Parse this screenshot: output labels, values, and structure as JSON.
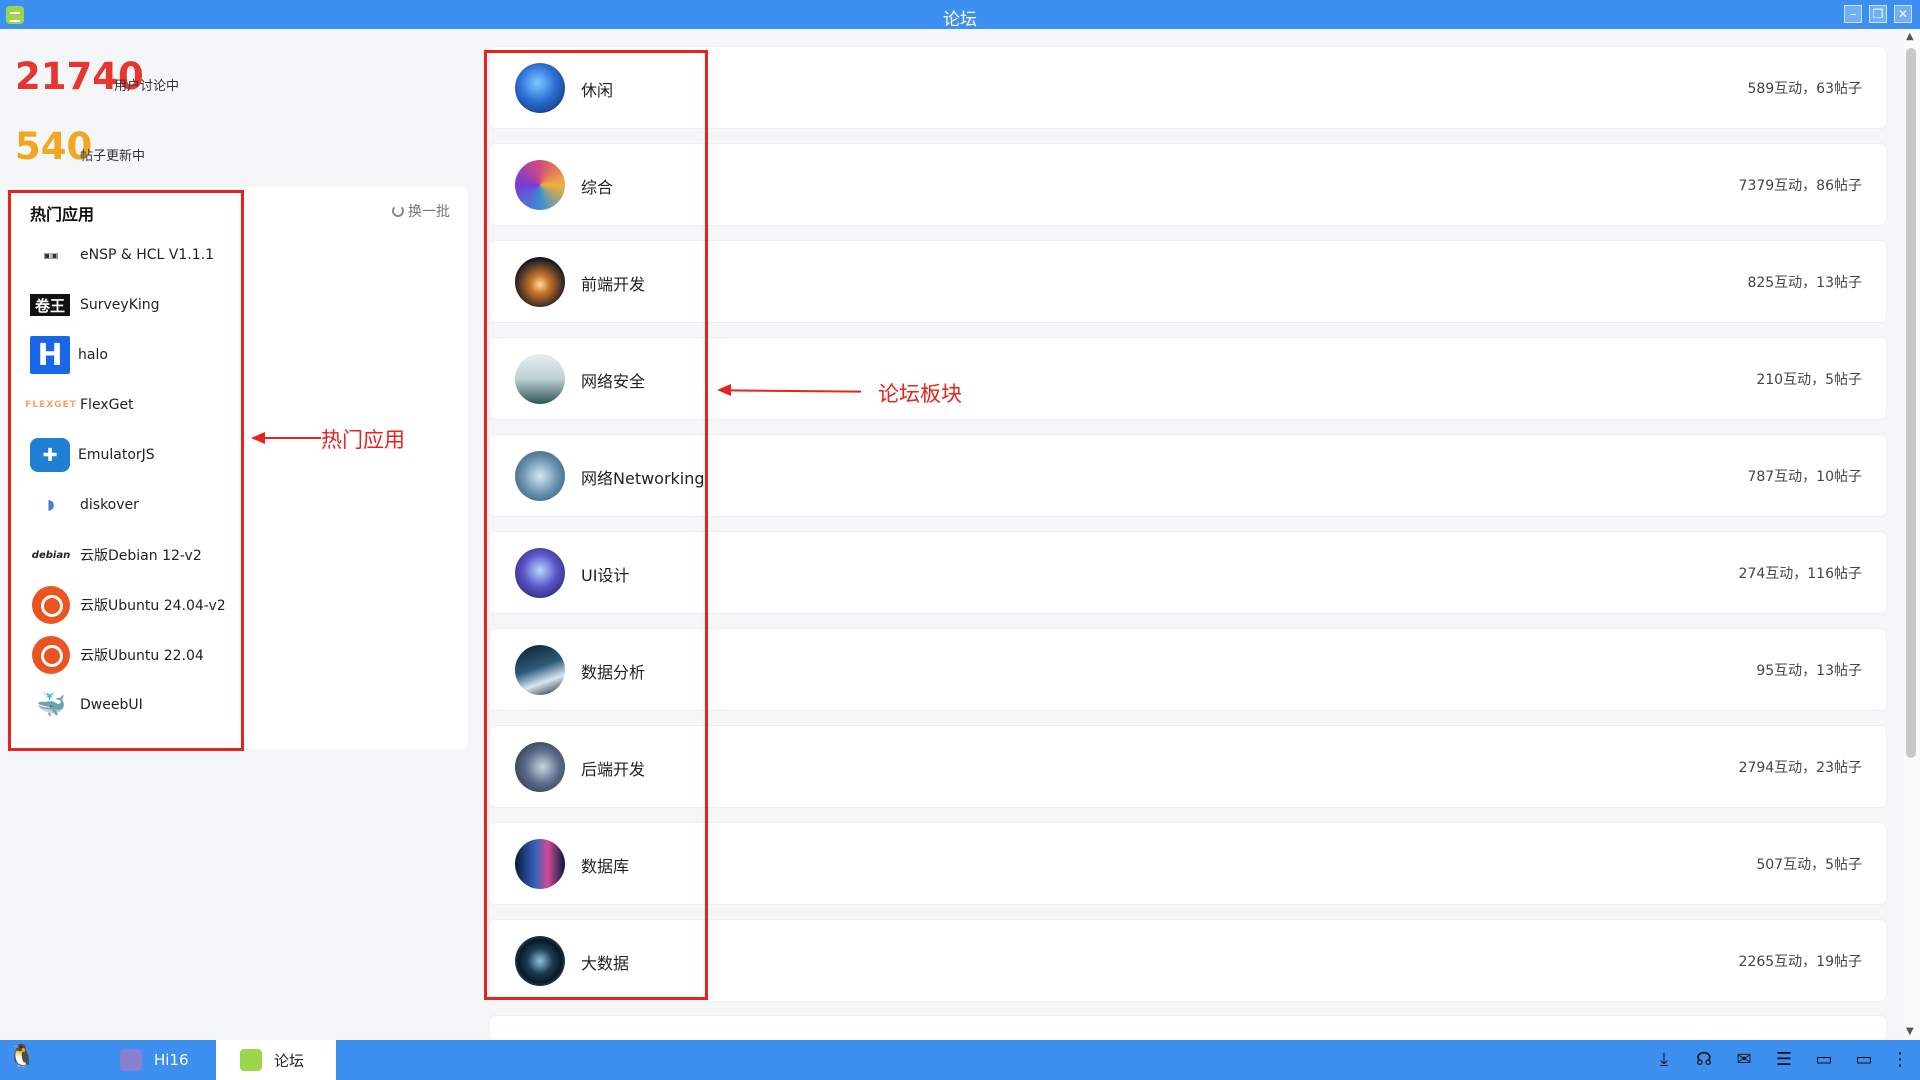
{
  "window": {
    "title": "论坛"
  },
  "stats": {
    "users_count": "21740",
    "users_label": "用户讨论中",
    "posts_count": "540",
    "posts_label": "帖子更新中"
  },
  "hot_apps": {
    "title": "热门应用",
    "refresh_label": "换一批",
    "items": [
      {
        "name": "eNSP & HCL V1.1.1",
        "icon": "ensp-icon"
      },
      {
        "name": "SurveyKing",
        "icon": "surveyking-icon",
        "logo_text": "卷王"
      },
      {
        "name": "halo",
        "icon": "halo-icon",
        "logo_text": "H"
      },
      {
        "name": "FlexGet",
        "icon": "flexget-icon",
        "logo_text": "FLEXGET"
      },
      {
        "name": "EmulatorJS",
        "icon": "emulatorjs-icon"
      },
      {
        "name": "diskover",
        "icon": "diskover-icon"
      },
      {
        "name": "云版Debian 12-v2",
        "icon": "debian-icon",
        "logo_text": "debian"
      },
      {
        "name": "云版Ubuntu 24.04-v2",
        "icon": "ubuntu-icon"
      },
      {
        "name": "云版Ubuntu 22.04",
        "icon": "ubuntu-icon"
      },
      {
        "name": "DweebUI",
        "icon": "dweebui-icon"
      }
    ]
  },
  "annotations": {
    "hot_apps_label": "热门应用",
    "forum_label": "论坛板块",
    "color": "#e8221c"
  },
  "forum": {
    "boards": [
      {
        "name": "休闲",
        "stats": "589互动，63帖子",
        "color": "#2b6fd6"
      },
      {
        "name": "综合",
        "stats": "7379互动，86帖子",
        "color": "#d24a7a"
      },
      {
        "name": "前端开发",
        "stats": "825互动，13帖子",
        "color": "#c9742b"
      },
      {
        "name": "网络安全",
        "stats": "210互动，5帖子",
        "color": "#2e5557"
      },
      {
        "name": "网络Networking",
        "stats": "787互动，10帖子",
        "color": "#6a93b3"
      },
      {
        "name": "UI设计",
        "stats": "274互动，116帖子",
        "color": "#5a55c9"
      },
      {
        "name": "数据分析",
        "stats": "95互动，13帖子",
        "color": "#2b5a7a"
      },
      {
        "name": "后端开发",
        "stats": "2794互动，23帖子",
        "color": "#5b6d8a"
      },
      {
        "name": "数据库",
        "stats": "507互动，5帖子",
        "color": "#3064b8"
      },
      {
        "name": "大数据",
        "stats": "2265互动，19帖子",
        "color": "#1d3d55"
      }
    ]
  },
  "taskbar": {
    "items": [
      {
        "label": "Hi16",
        "active": false
      },
      {
        "label": "论坛",
        "active": true
      }
    ],
    "tray_icons": [
      "download-icon",
      "headset-icon",
      "wechat-icon",
      "notes-icon",
      "chat-icon",
      "display-icon",
      "more-icon"
    ]
  },
  "colors": {
    "accent": "#3d8ff0",
    "users_count": "#e8352f",
    "posts_count": "#f2a623"
  }
}
